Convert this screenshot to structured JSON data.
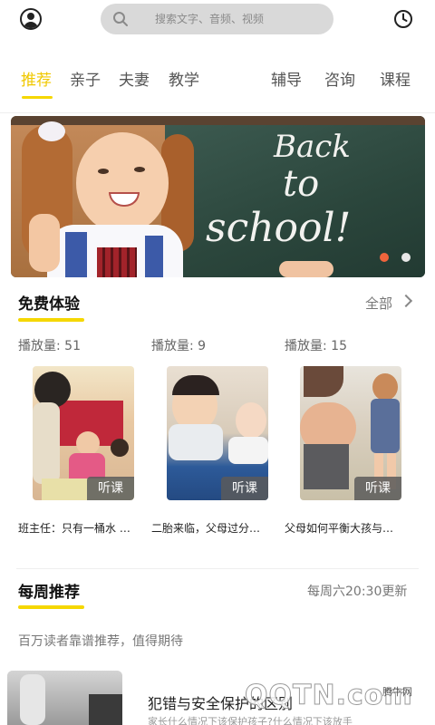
{
  "search": {
    "placeholder": "搜索文字、音频、视频"
  },
  "tabs": {
    "left": [
      "推荐",
      "亲子",
      "夫妻",
      "教学"
    ],
    "right": [
      "辅导",
      "咨询",
      "课程"
    ],
    "active_index": 0
  },
  "banner": {
    "chalk_lines": [
      "Back",
      "to",
      "school!"
    ],
    "page_count": 2,
    "active_page": 0
  },
  "free_trial": {
    "title": "免费体验",
    "more_label": "全部",
    "items": [
      {
        "plays": "播放量: 51",
        "badge": "听课",
        "title": "班主任：只有一桶水 …"
      },
      {
        "plays": "播放量: 9",
        "badge": "听课",
        "title": "二胎来临，父母过分…"
      },
      {
        "plays": "播放量: 15",
        "badge": "听课",
        "title": "父母如何平衡大孩与…"
      }
    ]
  },
  "weekly": {
    "title": "每周推荐",
    "schedule": "每周六20:30更新",
    "subtitle": "百万读者靠谱推荐，值得期待"
  },
  "article": {
    "title": "犯错与安全保护的区别",
    "desc": "家长什么情况下该保护孩子?什么情况下该放手"
  },
  "watermark": {
    "site": "腾牛网",
    "logo": "QQTN.com"
  },
  "colors": {
    "accent": "#f5d700",
    "active_tab": "#f0c800"
  }
}
